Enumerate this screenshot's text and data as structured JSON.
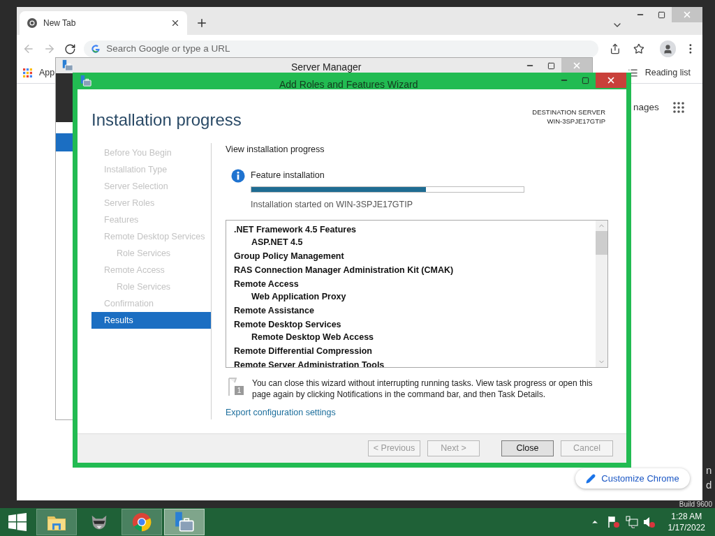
{
  "desktop": {
    "watermark": [
      "n",
      "d",
      "Build 9600"
    ]
  },
  "browser": {
    "tab": {
      "title": "New Tab",
      "selected": true
    },
    "omnibox": {
      "placeholder": "Search Google or type a URL"
    },
    "bookmarks": {
      "apps": "App",
      "reading_list": "Reading list"
    },
    "page": {
      "images_link": "nages",
      "customize_button": "Customize Chrome"
    }
  },
  "server_manager": {
    "title": "Server Manager"
  },
  "wizard": {
    "title": "Add Roles and Features Wizard",
    "heading": "Installation progress",
    "destination": {
      "label": "DESTINATION SERVER",
      "server": "WIN-3SPJE17GTIP"
    },
    "steps": [
      {
        "label": "Before You Begin",
        "selected": false,
        "disabled": true
      },
      {
        "label": "Installation Type",
        "selected": false,
        "disabled": true
      },
      {
        "label": "Server Selection",
        "selected": false,
        "disabled": true
      },
      {
        "label": "Server Roles",
        "selected": false,
        "disabled": true
      },
      {
        "label": "Features",
        "selected": false,
        "disabled": true
      },
      {
        "label": "Remote Desktop Services",
        "selected": false,
        "disabled": true,
        "children": [
          {
            "label": "Role Services",
            "selected": false,
            "disabled": true
          }
        ]
      },
      {
        "label": "Remote Access",
        "selected": false,
        "disabled": true,
        "children": [
          {
            "label": "Role Services",
            "selected": false,
            "disabled": true
          }
        ]
      },
      {
        "label": "Confirmation",
        "selected": false,
        "disabled": true
      },
      {
        "label": "Results",
        "selected": true,
        "disabled": false
      }
    ],
    "section_title": "View installation progress",
    "progress": {
      "label": "Feature installation",
      "level": 0.64,
      "status": "Installation started on WIN-3SPJE17GTIP"
    },
    "features": [
      {
        "label": ".NET Framework 4.5 Features",
        "children": [
          {
            "label": "ASP.NET 4.5"
          }
        ]
      },
      {
        "label": "Group Policy Management"
      },
      {
        "label": "RAS Connection Manager Administration Kit (CMAK)"
      },
      {
        "label": "Remote Access",
        "children": [
          {
            "label": "Web Application Proxy"
          }
        ]
      },
      {
        "label": "Remote Assistance"
      },
      {
        "label": "Remote Desktop Services",
        "children": [
          {
            "label": "Remote Desktop Web Access"
          }
        ]
      },
      {
        "label": "Remote Differential Compression"
      },
      {
        "label": "Remote Server Administration Tools"
      }
    ],
    "note": "You can close this wizard without interrupting running tasks. View task progress or open this page again by clicking Notifications in the command bar, and then Task Details.",
    "note_badge": "1",
    "export_link": "Export configuration settings",
    "buttons": [
      {
        "label": "< Previous",
        "disabled": true,
        "focused": false
      },
      {
        "label": "Next >",
        "disabled": true,
        "focused": false
      },
      {
        "label": "Close",
        "disabled": false,
        "focused": true
      },
      {
        "label": "Cancel",
        "disabled": true,
        "focused": false
      }
    ]
  },
  "taskbar": {
    "apps": [
      {
        "kind": "explorer",
        "running": true,
        "active": false
      },
      {
        "kind": "raccoon",
        "running": false,
        "active": false
      },
      {
        "kind": "chrome",
        "running": true,
        "active": false
      },
      {
        "kind": "servermanager",
        "running": true,
        "active": true
      }
    ],
    "clock": {
      "time": "1:28 AM",
      "date": "1/17/2022"
    }
  }
}
